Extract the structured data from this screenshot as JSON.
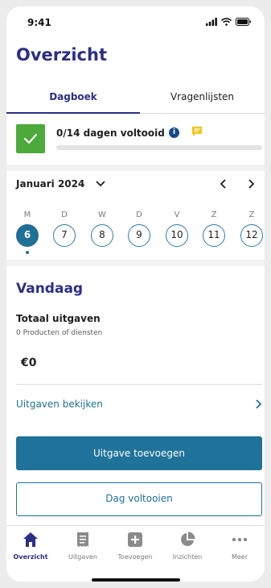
{
  "status_bar": {
    "time": "9:41"
  },
  "header": {
    "title": "Overzicht"
  },
  "tabs": [
    {
      "label": "Dagboek",
      "active": true
    },
    {
      "label": "Vragenlijsten",
      "active": false
    }
  ],
  "progress": {
    "label": "0/14 dagen voltooid",
    "completed": 0,
    "total": 14,
    "info_icon": "i"
  },
  "calendar": {
    "month": "Januari 2024",
    "days": [
      {
        "letter": "M",
        "number": "6",
        "selected": true
      },
      {
        "letter": "D",
        "number": "7",
        "selected": false
      },
      {
        "letter": "W",
        "number": "8",
        "selected": false
      },
      {
        "letter": "D",
        "number": "9",
        "selected": false
      },
      {
        "letter": "V",
        "number": "10",
        "selected": false
      },
      {
        "letter": "Z",
        "number": "11",
        "selected": false
      },
      {
        "letter": "Z",
        "number": "12",
        "selected": false
      }
    ]
  },
  "today": {
    "title": "Vandaag",
    "total_label": "Totaal uitgaven",
    "total_sub": "0 Producten of diensten",
    "total_amount": "€0",
    "view_link": "Uitgaven bekijken",
    "add_button": "Uitgave toevoegen",
    "complete_button": "Dag voltooien"
  },
  "bottom_nav": [
    {
      "label": "Overzicht",
      "icon": "home-icon",
      "active": true
    },
    {
      "label": "Uitgaven",
      "icon": "receipt-icon",
      "active": false
    },
    {
      "label": "Toevoegen",
      "icon": "add-icon",
      "active": false
    },
    {
      "label": "Inzichten",
      "icon": "pie-chart-icon",
      "active": false
    },
    {
      "label": "Meer",
      "icon": "more-icon",
      "active": false
    }
  ],
  "colors": {
    "brand": "#2b2f86",
    "accent": "#1f7299",
    "success": "#4caa3a",
    "note": "#f3c612"
  }
}
